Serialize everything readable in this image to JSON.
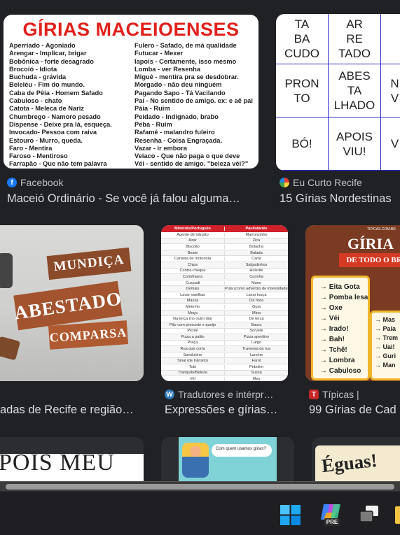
{
  "results": [
    {
      "source": "Facebook",
      "title": "Maceió Ordinário - Se você já falou alguma…",
      "image": {
        "heading": "GÍRIAS MACEIOENSES",
        "left_col": [
          "Aperriado - Agoniado",
          "Arengar - Implicar, brigar",
          "Bobônica - forte desagrado",
          "Brocoió - Idiota",
          "Buchuda - grávida",
          "Beleléu - Fim do mundo.",
          "Caba de Pêia - Homem Safado",
          "Cabuloso - chato",
          "Catota - Meleca de Nariz",
          "Chumbrego - Namoro pesado",
          "Dispense - Deixe pra lá, esqueça.",
          "Invocado- Pessoa com raiva",
          "Estouro - Murro, queda.",
          "Faro - Mentira",
          "Faroso - Mentiroso",
          "Farrapão - Que não tem palavra"
        ],
        "right_col": [
          "Fulero - Safado, de má qualidade",
          "Futucar - Mexer",
          "Iapois - Certamente, isso mesmo",
          "Lomba - ver Resenha",
          "Miguê - mentira pra se desdobrar.",
          "Morgado - não deu ninguém",
          "Pagando Sapo - Tá Vacilando",
          "Paí - No sentido de amigo. ex: e aê pai",
          "Páia - Ruim",
          "Peidado - Indignado, brabo",
          "Peba - Ruim",
          "Rafamé - malandro fuleiro",
          "Resenha - Coisa Engraçada.",
          "Vazar - ir embora",
          "Veiaco - Que não paga o que deve",
          "Véi - sentido de amigo. \"beleza véi?\""
        ]
      }
    },
    {
      "source": "Eu Curto Recife",
      "title": "15 Gírias Nordestinas",
      "image": {
        "cells": [
          "TA\nBA\nCUDO",
          "AR\nRE\nTADO",
          "",
          "PRON\nTO",
          "ABES\nTA\nLHADO",
          "N\nV",
          "BÓ!",
          "APOIS\nVIU!",
          "V"
        ]
      }
    },
    {
      "source": "",
      "title": "adas de Recife e região…",
      "image": {
        "words": [
          "MUNDIÇA",
          "ABESTADO",
          "COMPARSA"
        ]
      }
    },
    {
      "source": "Tradutores e intérpr…",
      "title": "Expressões e gírias…",
      "image": {
        "headers": [
          "Mineirês/Português",
          "Paulistanês"
        ],
        "rows": [
          [
            "Agente de trânsito",
            "Marronzinho"
          ],
          [
            "Azar",
            "Zica"
          ],
          [
            "Biscoito",
            "Bolacha"
          ],
          [
            "Boate",
            "Balada"
          ],
          [
            "Carteira de motorista",
            "Carta"
          ],
          [
            "Chips",
            "Salgadinhos"
          ],
          [
            "Contra-cheque",
            "Holerite"
          ],
          [
            "Corinthians",
            "Curinha"
          ],
          [
            "Cuspadi",
            "Mano"
          ],
          [
            "Demais",
            "Puta (como advérbio de intensidade)"
          ],
          [
            "Lavar vasilhas",
            "Lavar louça"
          ],
          [
            "Massa",
            "Da hora"
          ],
          [
            "Meio-fio",
            "Guia"
          ],
          [
            "Moça",
            "Mina"
          ],
          [
            "Na terça (no outro dia)",
            "De terça"
          ],
          [
            "Pão com presunto e queijo",
            "Bauru"
          ],
          [
            "Picolé",
            "Sorvete"
          ],
          [
            "Pizza a palito",
            "Pizza aperitivo"
          ],
          [
            "Praça",
            "Largo"
          ],
          [
            "Rua que corta",
            "Travessa da rua"
          ],
          [
            "Sanduíche",
            "Lanche"
          ],
          [
            "Sinal (de trânsito)",
            "Farol"
          ],
          [
            "Totó",
            "Pebolim"
          ],
          [
            "Tranquilo/Beleza",
            "Sussa"
          ],
          [
            "Véi",
            "Meu"
          ]
        ]
      }
    },
    {
      "source": "Típicas |",
      "title": "99 Gírias de Cad",
      "image": {
        "site": "TIPICAS.COM.BR",
        "heading": "GÍRIA",
        "subheading": "DE TODO O BR",
        "list1": [
          "→ Eita Gota",
          "→ Pomba lesa",
          "→ Oxe",
          "→ Véi",
          "→ Irado!",
          "→ Bah!",
          "→ Tchê!",
          "→ Lombra",
          "→ Cabuloso"
        ],
        "list2": [
          "→ Mas",
          "→ Paia",
          "→ Trem",
          "→ Uai!",
          "→ Guri",
          "→ Man"
        ]
      }
    }
  ],
  "bottom_row": {
    "left_text": "POIS MEU",
    "mid_caption": "Com quem usamos gírias?",
    "right_text": "Éguas!"
  },
  "taskbar": {
    "copilot_badge": "PRE"
  },
  "colors": {
    "page_bg": "#202124",
    "title_text": "#dadce0",
    "source_text": "#bdc1c6",
    "accent_red": "#e0201b",
    "grid_blue": "#2a2ad0"
  }
}
